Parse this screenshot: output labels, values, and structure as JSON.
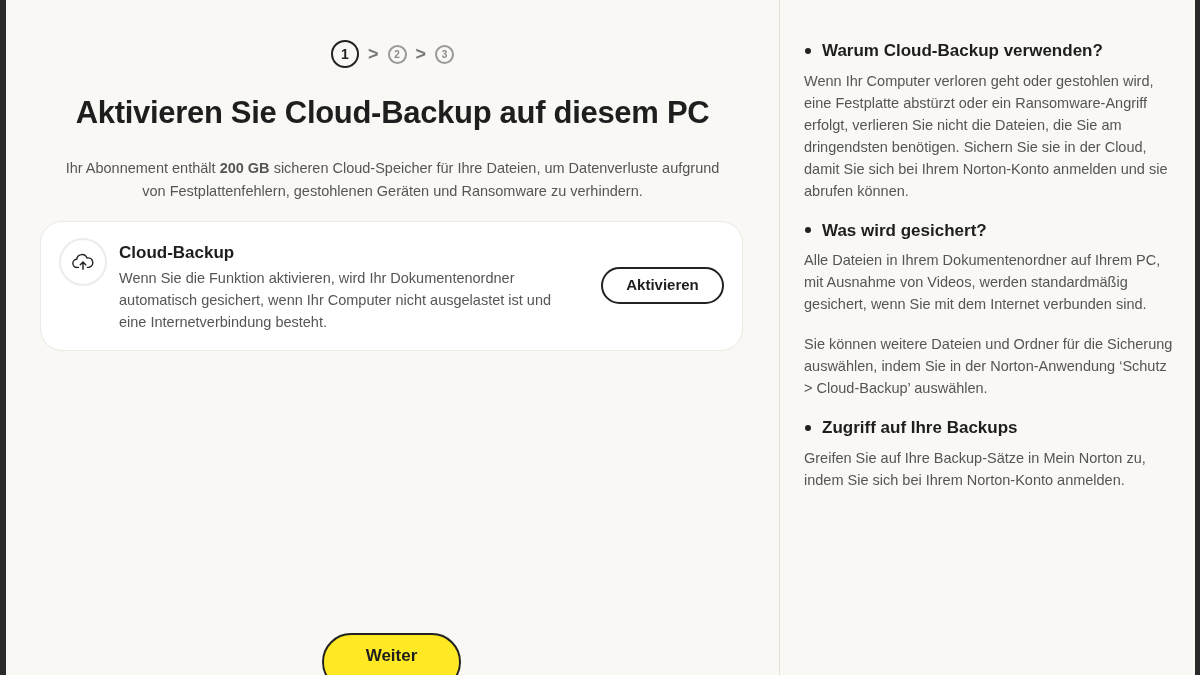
{
  "steps": [
    {
      "label": "1",
      "selected": true
    },
    {
      "label": "2",
      "selected": false
    },
    {
      "label": "3",
      "selected": false
    }
  ],
  "step_separator": ">",
  "heading": "Aktivieren Sie Cloud-Backup auf diesem PC",
  "intro": "Ihr Abonnement enthält **200 GB** sicheren Cloud-Speicher für Ihre Dateien, um Datenverluste aufgrund von Festplattenfehlern, gestohlenen Geräten und Ransomware zu verhindern.",
  "feature_card": {
    "title": "Cloud-Backup",
    "description": "Wenn Sie die Funktion aktivieren, wird Ihr Dokumentenordner automatisch gesichert, wenn Ihr Computer nicht ausgelastet ist und eine Internetverbindung besteht.",
    "button": "Aktivieren"
  },
  "next_button": "Weiter",
  "info_panel": [
    {
      "title": "Warum Cloud-Backup verwenden?",
      "paragraphs": [
        "Wenn Ihr Computer verloren geht oder gestohlen wird, eine Festplatte abstürzt oder ein Ransomware-Angriff erfolgt, verlieren Sie nicht die Dateien, die Sie am dringendsten benötigen. Sichern Sie sie in der Cloud, damit Sie sich bei Ihrem Norton-Konto anmelden und sie abrufen können."
      ]
    },
    {
      "title": "Was wird gesichert?",
      "paragraphs": [
        "Alle Dateien in Ihrem Dokumentenordner auf Ihrem PC, mit Ausnahme von Videos, werden standardmäßig gesichert, wenn Sie mit dem Internet verbunden sind.",
        "Sie können weitere Dateien und Ordner für die Sicherung auswählen, indem Sie in der Norton-Anwendung ‘Schutz > Cloud-Backup’ auswählen."
      ]
    },
    {
      "title": "Zugriff auf Ihre Backups",
      "paragraphs": [
        "Greifen Sie auf Ihre Backup-Sätze in Mein Norton zu, indem Sie sich bei Ihrem Norton-Konto anmelden."
      ]
    }
  ]
}
